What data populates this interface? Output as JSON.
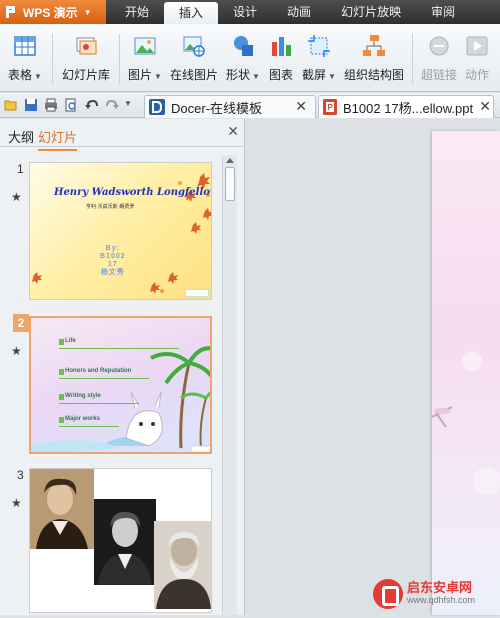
{
  "app": {
    "name": "WPS 演示"
  },
  "menu_tabs": [
    "开始",
    "插入",
    "设计",
    "动画",
    "幻灯片放映",
    "审阅"
  ],
  "active_tab": "插入",
  "ribbon": {
    "table": "表格",
    "slide_library": "幻灯片库",
    "picture": "图片",
    "online_picture": "在线图片",
    "shapes": "形状",
    "chart": "图表",
    "screenshot": "截屏",
    "org_chart": "组织结构图",
    "hyperlink": "超链接",
    "action": "动作"
  },
  "doc_tabs": {
    "docer": "Docer-在线模板",
    "active_file": "B1002 17杨...ellow.ppt"
  },
  "panel": {
    "tab_outline": "大纲",
    "tab_slides": "幻灯片",
    "slide_numbers": [
      "1",
      "2",
      "3"
    ]
  },
  "slide1": {
    "title": "Henry Wadsworth Longfellow",
    "subtitle": "亨利·沃兹沃斯·朗费罗",
    "by_lines": [
      "By:",
      "B1002",
      "17",
      "杨文秀"
    ]
  },
  "slide2": {
    "items": [
      "Life",
      "Honors and Reputation",
      "Writing style",
      "Major works"
    ]
  },
  "watermark": {
    "line1": "启东安卓网",
    "line2": "www.qdhfsh.com"
  },
  "colors": {
    "accent": "#e8893f",
    "titlebar": "#3a3a3a",
    "app_button": "#e0691e"
  }
}
